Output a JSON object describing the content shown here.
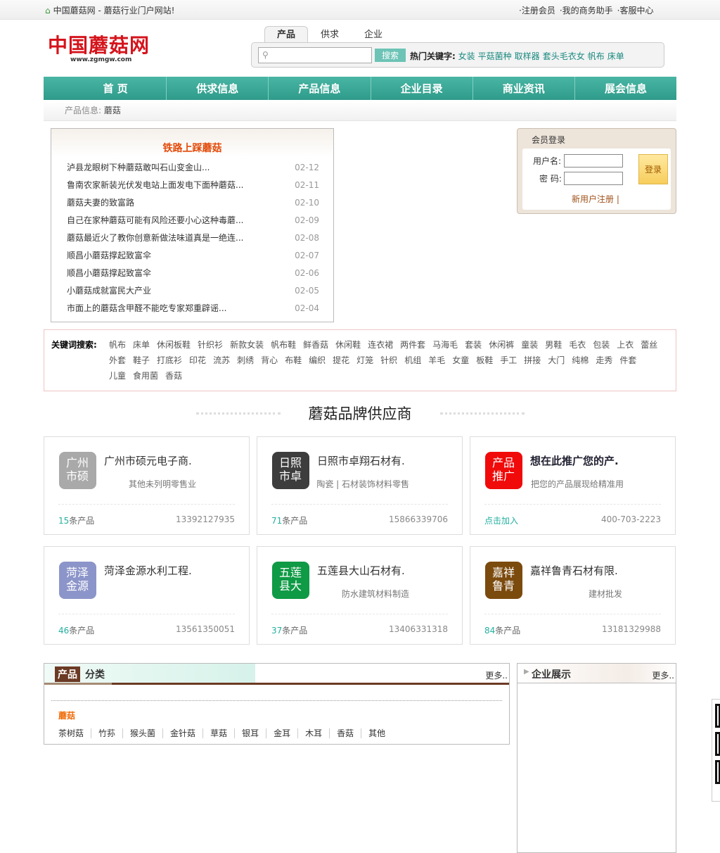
{
  "topbar": {
    "welcome": "中国蘑菇网 - 蘑菇行业门户网站!",
    "links": [
      "·注册会员",
      "·我的商务助手",
      "·客服中心"
    ]
  },
  "logo": {
    "name": "中国蘑菇网",
    "url_text": "www.zgmgw.com"
  },
  "search": {
    "tabs": [
      "产品",
      "供求",
      "企业"
    ],
    "active_tab": "产品",
    "value": "",
    "placeholder": "",
    "button": "搜索",
    "hot_label": "热门关键字:",
    "hot": [
      "女装",
      "平菇菌种",
      "取样器",
      "套头毛衣女",
      "帆布",
      "床单"
    ]
  },
  "nav": [
    "首 页",
    "供求信息",
    "产品信息",
    "企业目录",
    "商业资讯",
    "展会信息"
  ],
  "breadcrumb": {
    "prefix": "产品信息:",
    "current": "蘑菇"
  },
  "news": {
    "title": "铁路上踩蘑菇",
    "items": [
      {
        "t": "泸县龙眼树下种蘑菇敢叫石山变金山...",
        "d": "02-12"
      },
      {
        "t": "鲁南农家新装光伏发电站上面发电下面种蘑菇...",
        "d": "02-11"
      },
      {
        "t": "蘑菇夫妻的致富路",
        "d": "02-10"
      },
      {
        "t": "自己在家种蘑菇可能有风险还要小心这种毒蘑...",
        "d": "02-09"
      },
      {
        "t": "蘑菇最近火了教你创意新做法味道真是一绝连...",
        "d": "02-08"
      },
      {
        "t": "顺昌小蘑菇撑起致富伞",
        "d": "02-07"
      },
      {
        "t": "顺昌小蘑菇撑起致富伞",
        "d": "02-06"
      },
      {
        "t": "小蘑菇成就富民大产业",
        "d": "02-05"
      },
      {
        "t": "市面上的蘑菇含甲醛不能吃专家郑重辟谣...",
        "d": "02-04"
      }
    ]
  },
  "login": {
    "title": "会员登录",
    "user_label": "用户名:",
    "pass_label": "密 码:",
    "button": "登录",
    "register": "新用户注册 |"
  },
  "keywords": {
    "label": "关键词搜索:",
    "items": [
      "帆布",
      "床单",
      "休闲板鞋",
      "针织衫",
      "新款女装",
      "帆布鞋",
      "鲜香菇",
      "休闲鞋",
      "连衣裙",
      "两件套",
      "马海毛",
      "套装",
      "休闲裤",
      "童装",
      "男鞋",
      "毛衣",
      "包装",
      "上衣",
      "蕾丝",
      "外套",
      "鞋子",
      "打底衫",
      "印花",
      "流苏",
      "刺绣",
      "背心",
      "布鞋",
      "编织",
      "提花",
      "灯笼",
      "针织",
      "机组",
      "羊毛",
      "女童",
      "板鞋",
      "手工",
      "拼接",
      "大门",
      "纯棉",
      "走秀",
      "件套",
      "儿童",
      "食用菌",
      "香菇"
    ]
  },
  "suppliers": {
    "title": "蘑菇品牌供应商",
    "cards": [
      {
        "icon": "广州市硕",
        "color": "#a9a9a9",
        "name": "广州市硕元电子商.",
        "desc": "其他未列明零售业",
        "count": "15",
        "unit": "条产品",
        "phone": "13392127935"
      },
      {
        "icon": "日照市卓",
        "color": "#3d3d3d",
        "name": "日照市卓翔石材有.",
        "desc": "陶瓷 | 石材装饰材料零售",
        "count": "71",
        "unit": "条产品",
        "phone": "15866339706"
      },
      {
        "icon": "产品推广",
        "color": "#f00a0a",
        "name": "想在此推广您的产.",
        "desc": "把您的产品展现给精准用",
        "count": "点击加入",
        "unit": "",
        "phone": "400-703-2223",
        "promo": true
      },
      {
        "icon": "菏泽金源",
        "color": "#8c95c9",
        "name": "菏泽金源水利工程.",
        "desc": "",
        "count": "46",
        "unit": "条产品",
        "phone": "13561350051"
      },
      {
        "icon": "五莲县大",
        "color": "#0f9a45",
        "name": "五莲县大山石材有.",
        "desc": "防水建筑材料制造",
        "count": "37",
        "unit": "条产品",
        "phone": "13406331318"
      },
      {
        "icon": "嘉祥鲁青",
        "color": "#7b4a0d",
        "name": "嘉祥鲁青石材有限.",
        "desc": "建材批发",
        "count": "84",
        "unit": "条产品",
        "phone": "13181329988"
      }
    ]
  },
  "category": {
    "tag": "产品",
    "title": "分类",
    "more": "更多..",
    "name": "蘑菇",
    "subs": [
      "茶树菇",
      "竹荪",
      "猴头菌",
      "金针菇",
      "草菇",
      "银耳",
      "金耳",
      "木耳",
      "香菇",
      "其他"
    ]
  },
  "enterprise": {
    "title": "企业展示",
    "more": "更多.."
  }
}
